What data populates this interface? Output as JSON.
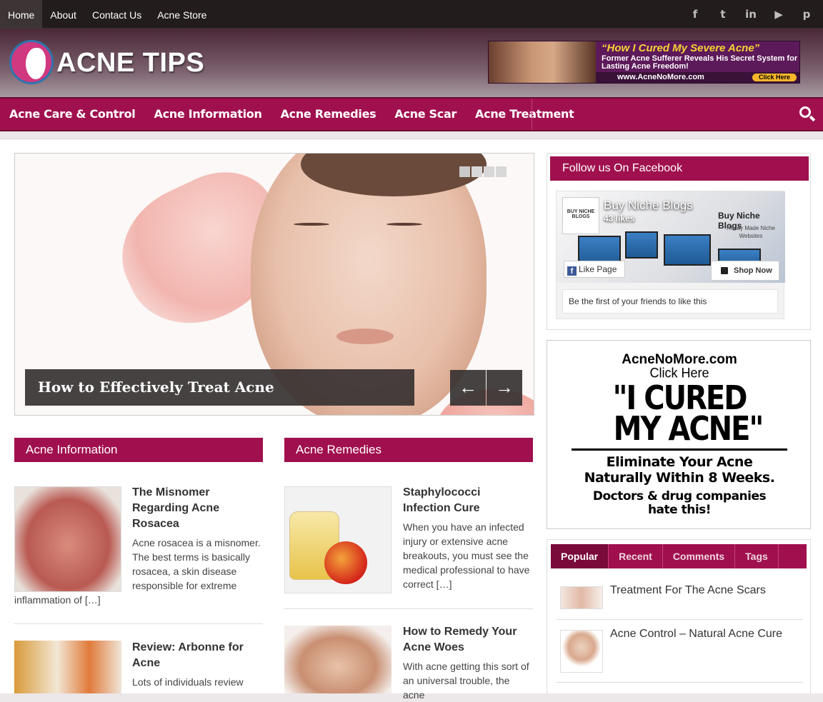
{
  "topnav": {
    "items": [
      {
        "label": "Home",
        "active": true
      },
      {
        "label": "About"
      },
      {
        "label": "Contact Us"
      },
      {
        "label": "Acne Store"
      }
    ],
    "social_icons": [
      "facebook-icon",
      "twitter-icon",
      "linkedin-icon",
      "youtube-icon",
      "pinterest-icon"
    ]
  },
  "header": {
    "logo_text": "ACNE TIPS",
    "ad": {
      "headline": "“How I Cured My Severe Acne”",
      "subline": "Former Acne Sufferer Reveals His Secret System for Lasting Acne Freedom!",
      "url": "www.AcneNoMore.com",
      "cta": "Click Here"
    }
  },
  "mainnav": {
    "items": [
      "Acne Care & Control",
      "Acne Information",
      "Acne Remedies",
      "Acne Scar",
      "Acne Treatment"
    ],
    "search_icon": "search-icon"
  },
  "slider": {
    "caption": "How to Effectively Treat Acne",
    "prev": "←",
    "next": "→",
    "slide_count": 4
  },
  "sections": {
    "left": {
      "title": "Acne Information",
      "posts": [
        {
          "title": "The Misnomer Regarding Acne Rosacea",
          "excerpt": "Acne rosacea is a misnomer. The best terms is basically rosacea, a skin disease responsible for extreme",
          "excerpt_tail": "inflammation of […]"
        },
        {
          "title": "Review: Arbonne for Acne",
          "excerpt": "Lots of individuals review"
        }
      ]
    },
    "right": {
      "title": "Acne Remedies",
      "posts": [
        {
          "title": "Staphylococci Infection Cure",
          "excerpt": "When you have an infected injury or extensive acne breakouts, you must see the medical professional to have correct […]"
        },
        {
          "title": "How to Remedy Your Acne Woes",
          "excerpt": "With acne getting this sort of an universal trouble, the acne"
        }
      ]
    }
  },
  "sidebar": {
    "facebook": {
      "title": "Follow us On Facebook",
      "page_name": "Buy Niche Blogs",
      "likes": "43 likes",
      "avatar_text": "BUY NICHE BLOGS",
      "cover_title": "Buy Niche Blogs",
      "cover_sub": "Ready Made Niche Websites",
      "like_button": "Like Page",
      "shop_button": "Shop Now",
      "friends_text": "Be the first of your friends to like this"
    },
    "ad": {
      "line1": "AcneNoMore.com",
      "line2": "Click Here",
      "big1": "\"I CURED",
      "big2": "MY ACNE\"",
      "line5": "Eliminate Your Acne",
      "line6": "Naturally Within 8 Weeks.",
      "line7": "Doctors & drug companies",
      "line8": "hate this!"
    },
    "tabs": {
      "labels": [
        "Popular",
        "Recent",
        "Comments",
        "Tags"
      ],
      "active": "Popular",
      "items": [
        {
          "title": "Treatment For The Acne Scars"
        },
        {
          "title": "Acne Control – Natural Acne Cure"
        }
      ]
    }
  },
  "colors": {
    "accent": "#a0104e",
    "topbar": "#221c1c"
  }
}
